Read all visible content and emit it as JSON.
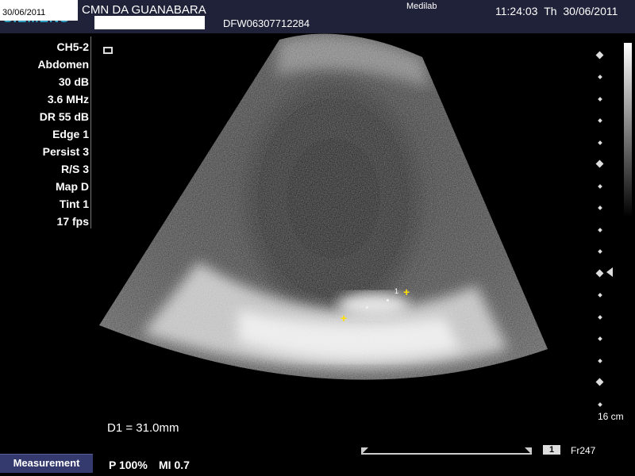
{
  "header": {
    "brand": "SIEMENS",
    "brand_date": "30/06/2011",
    "institution": "CMN DA GUANABARA",
    "patient_id": "DFW06307712284",
    "site": "Medilab",
    "time": "11:24:03",
    "day": "Th",
    "date": "30/06/2011"
  },
  "params": [
    "CH5-2",
    "Abdomen",
    "30 dB",
    "3.6 MHz",
    "DR 55 dB",
    "Edge 1",
    "Persist 3",
    "R/S 3",
    "Map D",
    "Tint 1",
    "17 fps"
  ],
  "measurement": {
    "label": "D1 = 31.0mm",
    "caliper_label": "1"
  },
  "depth_scale": {
    "label": "16 cm"
  },
  "footer": {
    "measurement_button": "Measurement",
    "power": "P 100%",
    "mi": "MI 0.7",
    "clip_number": "1",
    "frame": "Fr247"
  },
  "icons": {
    "probe_orientation": "probe-orientation-icon",
    "focus": "focus-marker-icon"
  }
}
